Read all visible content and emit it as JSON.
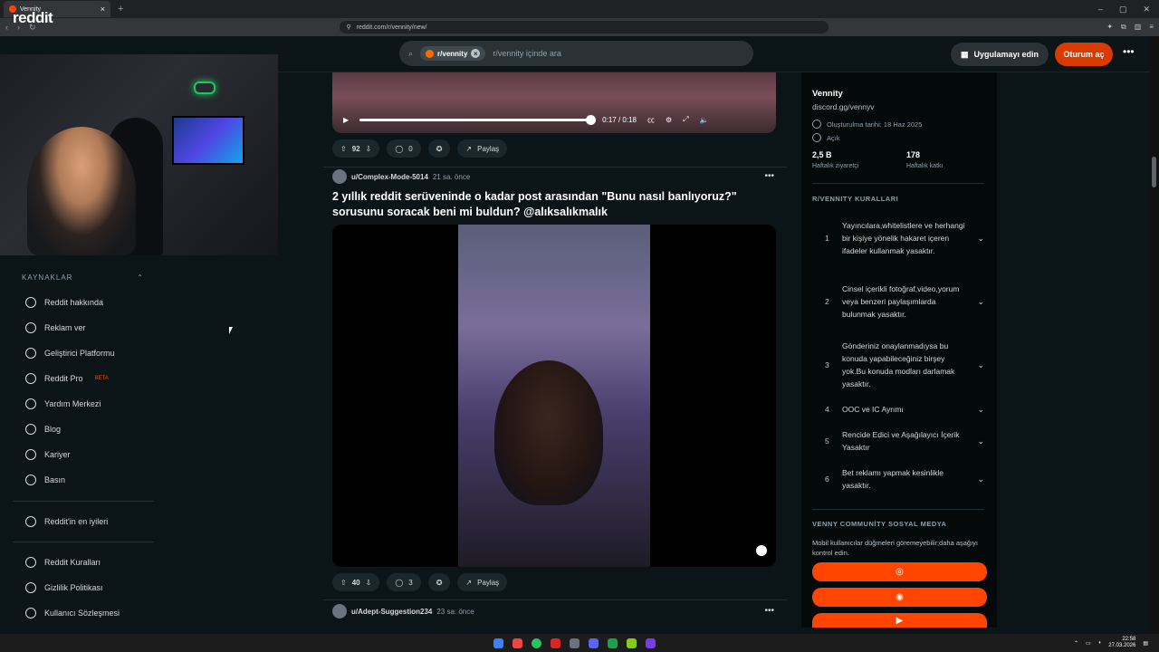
{
  "browser": {
    "tab_title": "Vennity",
    "new_tab": "+",
    "url": "reddit.com/r/vennity/new/",
    "win_controls": [
      "–",
      "▢",
      "✕"
    ]
  },
  "header": {
    "logo": "reddit",
    "search_chip": "r/vennity",
    "search_placeholder": "r/vennity içinde ara",
    "get_app": "Uygulamayı edin",
    "login": "Oturum aç",
    "more": "•••"
  },
  "sidebar": {
    "section": "KAYNAKLAR",
    "items": [
      {
        "label": "Reddit hakkında",
        "icon": "reddit-alien-icon"
      },
      {
        "label": "Reklam ver",
        "icon": "megaphone-icon"
      },
      {
        "label": "Geliştirici Platformu",
        "icon": "developer-platform-icon"
      },
      {
        "label": "Reddit Pro",
        "icon": "reddit-pro-icon",
        "badge": "BETA"
      },
      {
        "label": "Yardım Merkezi",
        "icon": "help-icon"
      },
      {
        "label": "Blog",
        "icon": "book-icon"
      },
      {
        "label": "Kariyer",
        "icon": "briefcase-icon"
      },
      {
        "label": "Basın",
        "icon": "press-icon"
      }
    ],
    "best": "Reddit'in en iyileri",
    "legal": [
      "Reddit Kuralları",
      "Gizlilik Politikası",
      "Kullanıcı Sözleşmesi"
    ]
  },
  "feed": {
    "video1": {
      "time": "0:17 / 0:18",
      "progress": 1.0
    },
    "post1_actions": {
      "votes": "92",
      "comments": "0",
      "share": "Paylaş"
    },
    "post2": {
      "user": "u/Complex-Mode-5014",
      "time": "21 sa. önce",
      "title": "2 yıllık reddit serüveninde o kadar post arasından \"Bunu nasıl banlıyoruz?\" sorusunu soracak beni mi buldun? @alıksalıkmalık",
      "votes": "40",
      "comments": "3",
      "share": "Paylaş"
    },
    "post3": {
      "user": "u/Adept-Suggestion234",
      "time": "23 sa. önce"
    }
  },
  "community": {
    "name": "Vennity",
    "link": "discord.gg/vennyv",
    "created": "Oluşturulma tarihi: 18 Haz 2025",
    "visibility": "Açık",
    "weekly_visitors": "2,5 B",
    "weekly_visitors_label": "Haftalık ziyaretçi",
    "weekly_contrib": "178",
    "weekly_contrib_label": "Haftalık katkı",
    "rules_title": "R/VENNITY KURALLARI",
    "rules": [
      {
        "n": "1",
        "text": "Yayıncılara,whitelistlere ve herhangi bir kişiye yönelik hakaret içeren ifadeler kullanmak yasaktır."
      },
      {
        "n": "2",
        "text": "Cinsel içerikli fotoğraf,video,yorum veya benzeri paylaşımlarda bulunmak yasaktır."
      },
      {
        "n": "3",
        "text": "Gönderiniz onaylanmadıysa bu konuda yapabileceğiniz birşey yok.Bu konuda modları darlamak yasaktır."
      },
      {
        "n": "4",
        "text": "OOC ve IC Ayrımı"
      },
      {
        "n": "5",
        "text": "Rencide Edici ve Aşağılayıcı İçerik Yasaktır"
      },
      {
        "n": "6",
        "text": "Bet reklamı yapmak kesinlikle yasaktır."
      }
    ],
    "social_title": "VENNY COMMUNİTY SOSYAL MEDYA",
    "social_desc": "Mobil kullanıcılar düğmeleri göremeyebilir;daha aşağıyı kontrol edin.",
    "social_buttons": [
      "website-icon",
      "discord-icon",
      "youtube-icon"
    ]
  },
  "taskbar": {
    "time": "22:58",
    "date": "27.03.2026"
  },
  "colors": {
    "accent": "#ff4500",
    "login": "#d93a00",
    "bg": "#0b1416"
  }
}
